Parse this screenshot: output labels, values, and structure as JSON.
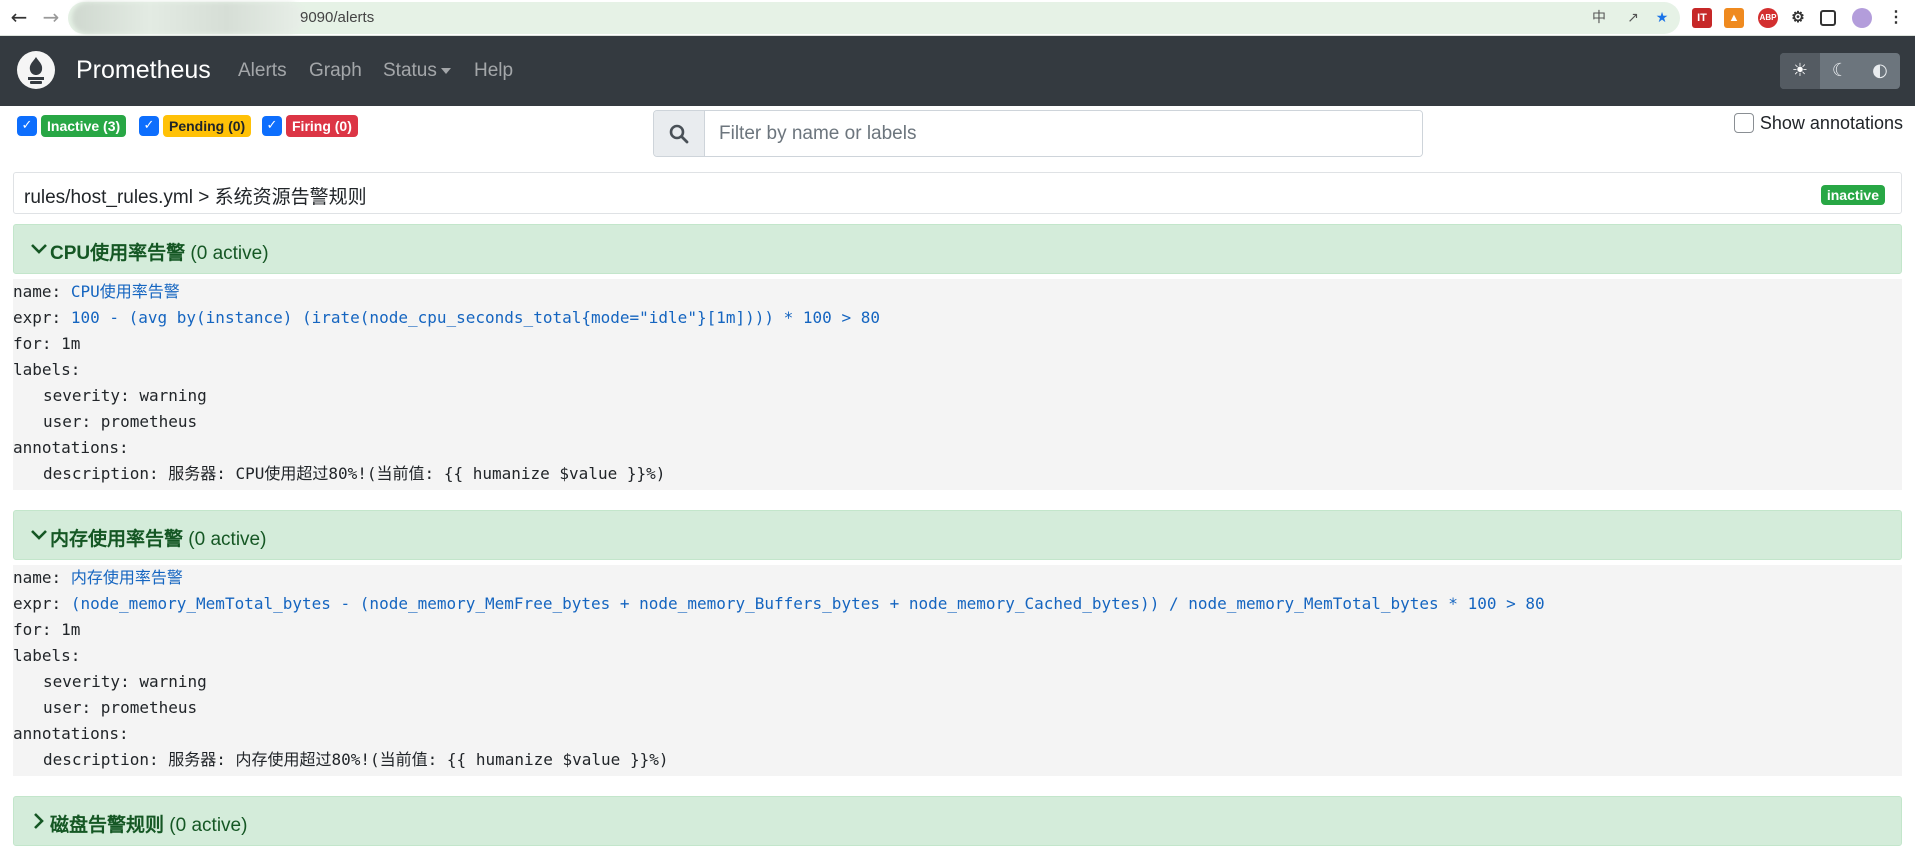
{
  "browser": {
    "url": "9090/alerts"
  },
  "navbar": {
    "brand": "Prometheus",
    "links": {
      "alerts": "Alerts",
      "graph": "Graph",
      "status": "Status",
      "help": "Help"
    },
    "theme_icons": [
      "sun-icon",
      "moon-icon",
      "contrast-icon"
    ]
  },
  "filters": {
    "inactive": "Inactive (3)",
    "pending": "Pending (0)",
    "firing": "Firing (0)",
    "search_placeholder": "Filter by name or labels",
    "show_annotations": "Show annotations"
  },
  "rule_file": {
    "title": "rules/host_rules.yml > 系统资源告警规则",
    "state": "inactive"
  },
  "rules": [
    {
      "name": "CPU使用率告警",
      "active": "(0 active)",
      "expanded": true,
      "body": {
        "name_key": "name:",
        "name_value": "CPU使用率告警",
        "expr_key": "expr:",
        "expr_value": "100 - (avg by(instance) (irate(node_cpu_seconds_total{mode=\"idle\"}[1m]))) * 100 > 80",
        "for_line": "for: 1m",
        "labels_key": "labels:",
        "severity": "severity: warning",
        "user": "user: prometheus",
        "annotations_key": "annotations:",
        "description": "description: 服务器: CPU使用超过80%!(当前值: {{ humanize $value }}%)"
      }
    },
    {
      "name": "内存使用率告警",
      "active": "(0 active)",
      "expanded": true,
      "body": {
        "name_key": "name:",
        "name_value": "内存使用率告警",
        "expr_key": "expr:",
        "expr_value": "(node_memory_MemTotal_bytes - (node_memory_MemFree_bytes + node_memory_Buffers_bytes + node_memory_Cached_bytes)) / node_memory_MemTotal_bytes * 100 > 80",
        "for_line": "for: 1m",
        "labels_key": "labels:",
        "severity": "severity: warning",
        "user": "user: prometheus",
        "annotations_key": "annotations:",
        "description": "description: 服务器: 内存使用超过80%!(当前值: {{ humanize $value }}%)"
      }
    },
    {
      "name": "磁盘告警规则",
      "active": "(0 active)",
      "expanded": false
    }
  ],
  "colors": {
    "navbar": "#343a40",
    "inactive_green": "#28a745",
    "pending_yellow": "#ffc107",
    "firing_red": "#dc3545",
    "rule_header_bg": "#d4ecda",
    "value_blue": "#1565c0"
  }
}
